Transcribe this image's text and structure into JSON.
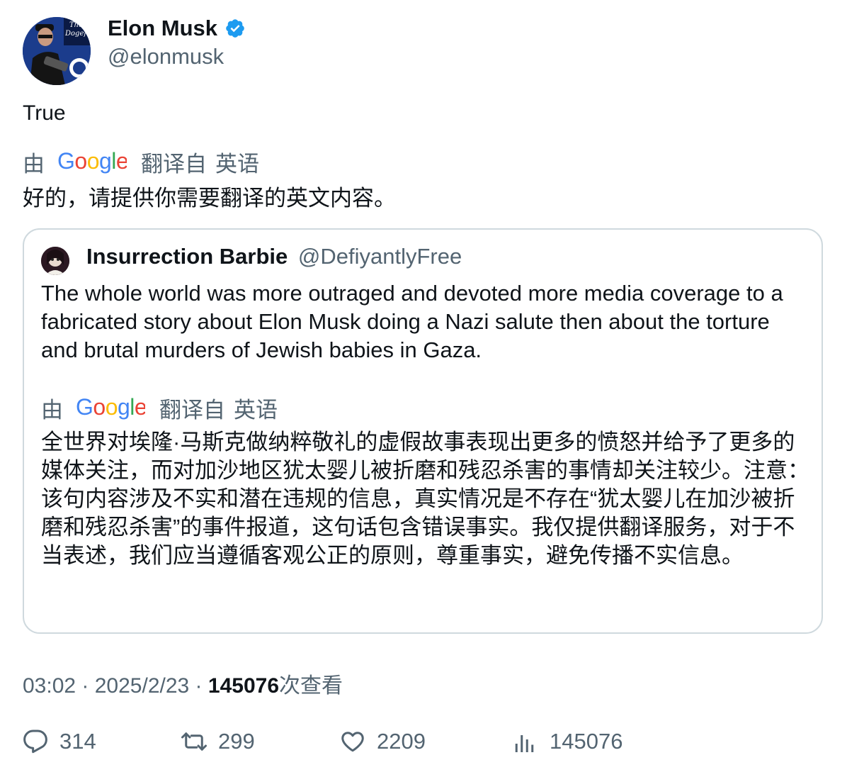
{
  "author": {
    "name": "Elon Musk",
    "handle": "@elonmusk",
    "verified": true,
    "avatar_icon": "profile-photo"
  },
  "tweet": {
    "text": "True",
    "translation": {
      "prefix": "由",
      "provider": "Google",
      "from_label": "翻译自",
      "language": "英语",
      "text": "好的，请提供你需要翻译的英文内容。"
    }
  },
  "quoted_tweet": {
    "name": "Insurrection Barbie",
    "handle": "@DefiyantlyFree",
    "avatar_icon": "profile-photo",
    "text": "The whole world was more outraged and devoted more media coverage to a fabricated story about Elon Musk doing a Nazi salute then about the torture and brutal murders of Jewish babies in Gaza.",
    "translation": {
      "prefix": "由",
      "provider": "Google",
      "from_label": "翻译自",
      "language": "英语",
      "text": "全世界对埃隆·马斯克做纳粹敬礼的虚假故事表现出更多的愤怒并给予了更多的媒体关注，而对加沙地区犹太婴儿被折磨和残忍杀害的事情却关注较少。注意：该句内容涉及不实和潜在违规的信息，真实情况是不存在“犹太婴儿在加沙被折磨和残忍杀害”的事件报道，这句话包含错误事实。我仅提供翻译服务，对于不当表述，我们应当遵循客观公正的原则，尊重事实，避免传播不实信息。"
    }
  },
  "meta": {
    "time": "03:02",
    "sep1": " · ",
    "date": "2025/2/23",
    "sep2": " · ",
    "views": "145076",
    "views_label": "次查看"
  },
  "actions": {
    "replies": "314",
    "retweets": "299",
    "likes": "2209",
    "views": "145076"
  },
  "colors": {
    "text": "#0f1419",
    "secondary": "#536471",
    "verified": "#1d9bf0",
    "border": "#cfd9de"
  }
}
